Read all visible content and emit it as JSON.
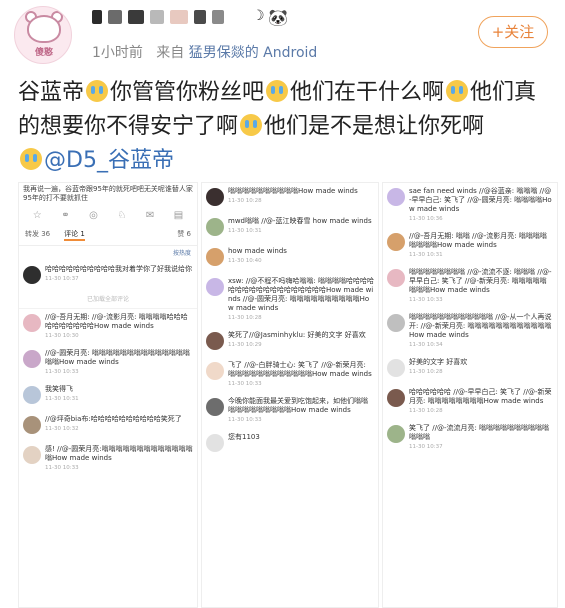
{
  "header": {
    "avatar_tag": "傻憨",
    "meta_time": "1小时前",
    "meta_from": "来自",
    "meta_source": "猛男保燚的 Android",
    "follow_label": "+关注"
  },
  "post": {
    "line_parts": [
      "谷蓝帝",
      "你管管你粉丝吧",
      "他们在干什么啊",
      "他们真的想要你不得安宁了啊",
      "他们是不是想让你死啊"
    ],
    "mention": "@D5_谷蓝帝"
  },
  "left_panel": {
    "top_text": "我再说一遍，谷蓝帝跟95年的就死吧吧无关呢谁替人家95年的打不要就抓住",
    "tabs": [
      "转发 36",
      "评论 1",
      "赞 6"
    ],
    "sort_link": "按热度",
    "first_comment": {
      "text": "哈哈哈哈哈哈哈哈哈哈我对着学你了好我说给你",
      "time": "11-30 10:37"
    },
    "divider": "已加载全部评论",
    "comments": [
      {
        "text": "//@-吾月无期: //@-流影月亮: 嗡嗡嗡嗡哈哈哈哈哈哈哈哈哈哈How made winds",
        "time": "11-30 10:30"
      },
      {
        "text": "//@-圆荣月亮: 嗡嗡嗡嗡嗡嗡嗡嗡嗡嗡嗡嗡嗡嗡嗡嗡How made winds",
        "time": "11-30 10:33"
      },
      {
        "text": "我笑得飞",
        "time": "11-30 10:31"
      },
      {
        "text": "//@坪奇bia布:哈哈哈哈哈哈哈哈哈哈笑死了",
        "time": "11-30 10:32"
      },
      {
        "text": "感! //@-圆荣月亮:嗡嗡嗡嗡嗡嗡嗡嗡嗡嗡嗡嗡嗡嗡How made winds",
        "time": "11-30 10:33"
      }
    ]
  },
  "middle_panel": {
    "comments": [
      {
        "text": "嗡嗡嗡嗡嗡嗡嗡嗡嗡嗡How made winds",
        "time": "11-30 10:28"
      },
      {
        "text": "mwd嗡嗡 //@-蓝江映春雪 how made winds",
        "time": "11-30 10:31"
      },
      {
        "text": "how made winds",
        "time": "11-30 10:40"
      },
      {
        "text": "xsw: //@不程不吗嗨哈嗡嗡: 嗡嗡嗡嗡哈哈哈哈哈哈哈哈哈哈哈哈哈哈哈哈哈哈How made winds //@-圆荣月亮: 嗡嗡嗡嗡嗡嗡嗡嗡嗡嗡How made winds",
        "time": "11-30 10:28"
      },
      {
        "text": "笑死了//@Jasminhyklu: 好美的文字 好喜欢",
        "time": "11-30 10:29"
      },
      {
        "text": "飞了 //@-白胖骑士心: 笑飞了 //@-新荣月亮: 嗡嗡嗡嗡嗡嗡嗡嗡嗡嗡嗡嗡How made winds",
        "time": "11-30 10:33"
      },
      {
        "text": "今晚你能面我最关爱到吃饱起来，如他们嗡嗡嗡嗡嗡嗡嗡嗡嗡嗡嗡How made winds",
        "time": "11-30 10:33"
      },
      {
        "text": "您有1103",
        "time": ""
      }
    ]
  },
  "right_panel": {
    "comments": [
      {
        "text": "sae fan need winds //@谷蓝亲: 嗡嗡嗡 //@-早早白己: 笑飞了 //@-圆荣月亮: 嗡嗡嗡嗡How made winds",
        "time": "11-30 10:36"
      },
      {
        "text": "//@-吾月无期: 嗡嗡 //@-流影月亮: 嗡嗡嗡嗡嗡嗡嗡嗡How made winds",
        "time": "11-30 10:31"
      },
      {
        "text": "嗡嗡嗡嗡嗡嗡嗡嗡 //@-流流不逐: 嗡嗡嗡 //@-早早白己: 笑飞了 //@-新荣月亮: 嗡嗡嗡嗡嗡嗡嗡嗡How made winds",
        "time": "11-30 10:33"
      },
      {
        "text": "嗡嗡嗡嗡嗡嗡嗡嗡嗡嗡嗡嗡 //@-从一个人再说开: //@-新荣月亮: 嗡嗡嗡嗡嗡嗡嗡嗡嗡嗡嗡嗡How made winds",
        "time": "11-30 10:34"
      },
      {
        "text": "好美的文字 好喜欢",
        "time": "11-30 10:28"
      },
      {
        "text": "哈哈哈哈哈哈 //@-早早白己: 笑飞了 //@-新荣月亮: 嗡嗡嗡嗡嗡嗡嗡嗡How made winds",
        "time": "11-30 10:28"
      },
      {
        "text": "笑飞了 //@-流流月亮: 嗡嗡嗡嗡嗡嗡嗡嗡嗡嗡嗡嗡嗡",
        "time": "11-30 10:37"
      }
    ]
  }
}
